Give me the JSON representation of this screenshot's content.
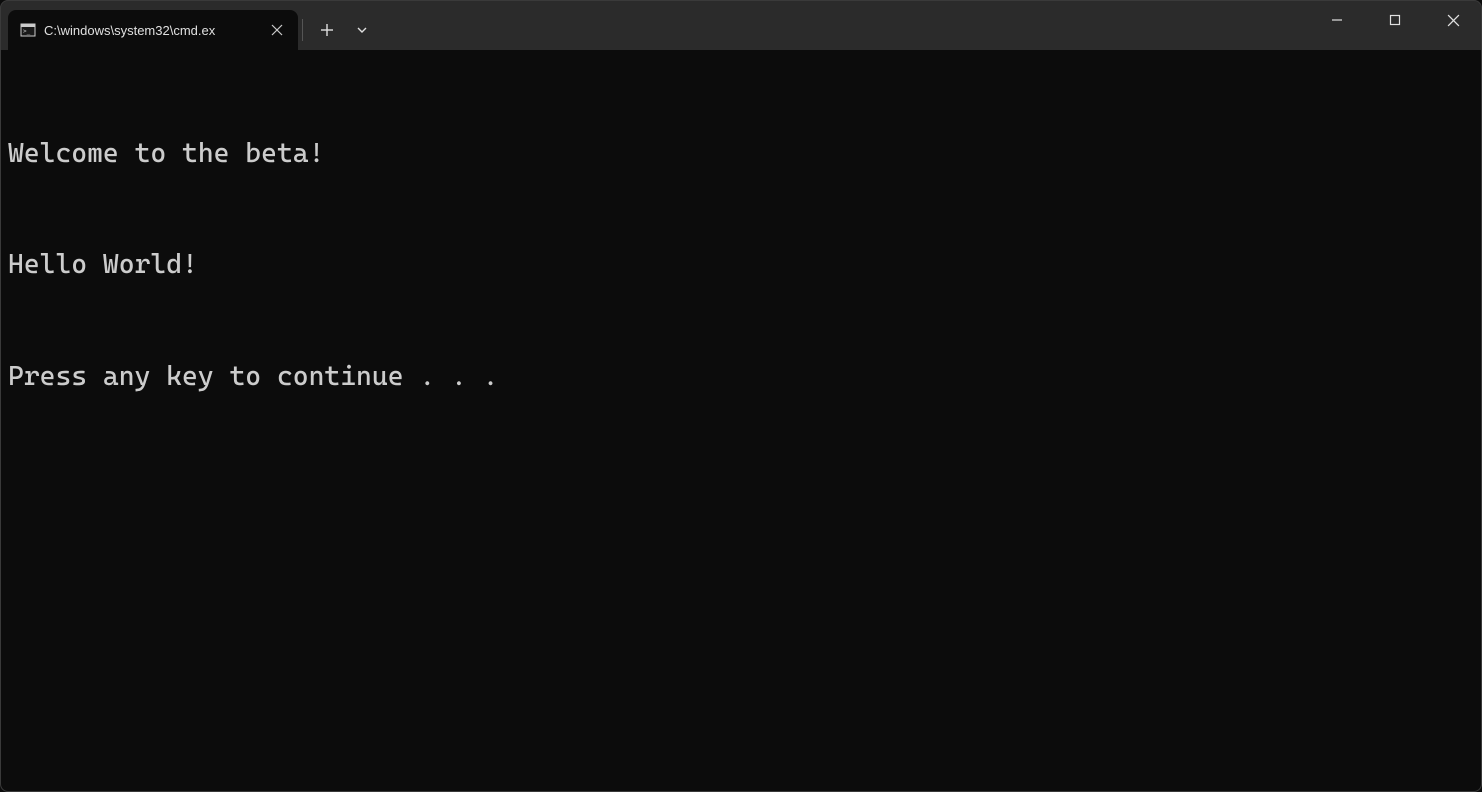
{
  "tab": {
    "title": "C:\\windows\\system32\\cmd.ex",
    "icon": "terminal-icon"
  },
  "terminal": {
    "lines": [
      "Welcome to the beta!",
      "Hello World!",
      "Press any key to continue . . ."
    ]
  }
}
